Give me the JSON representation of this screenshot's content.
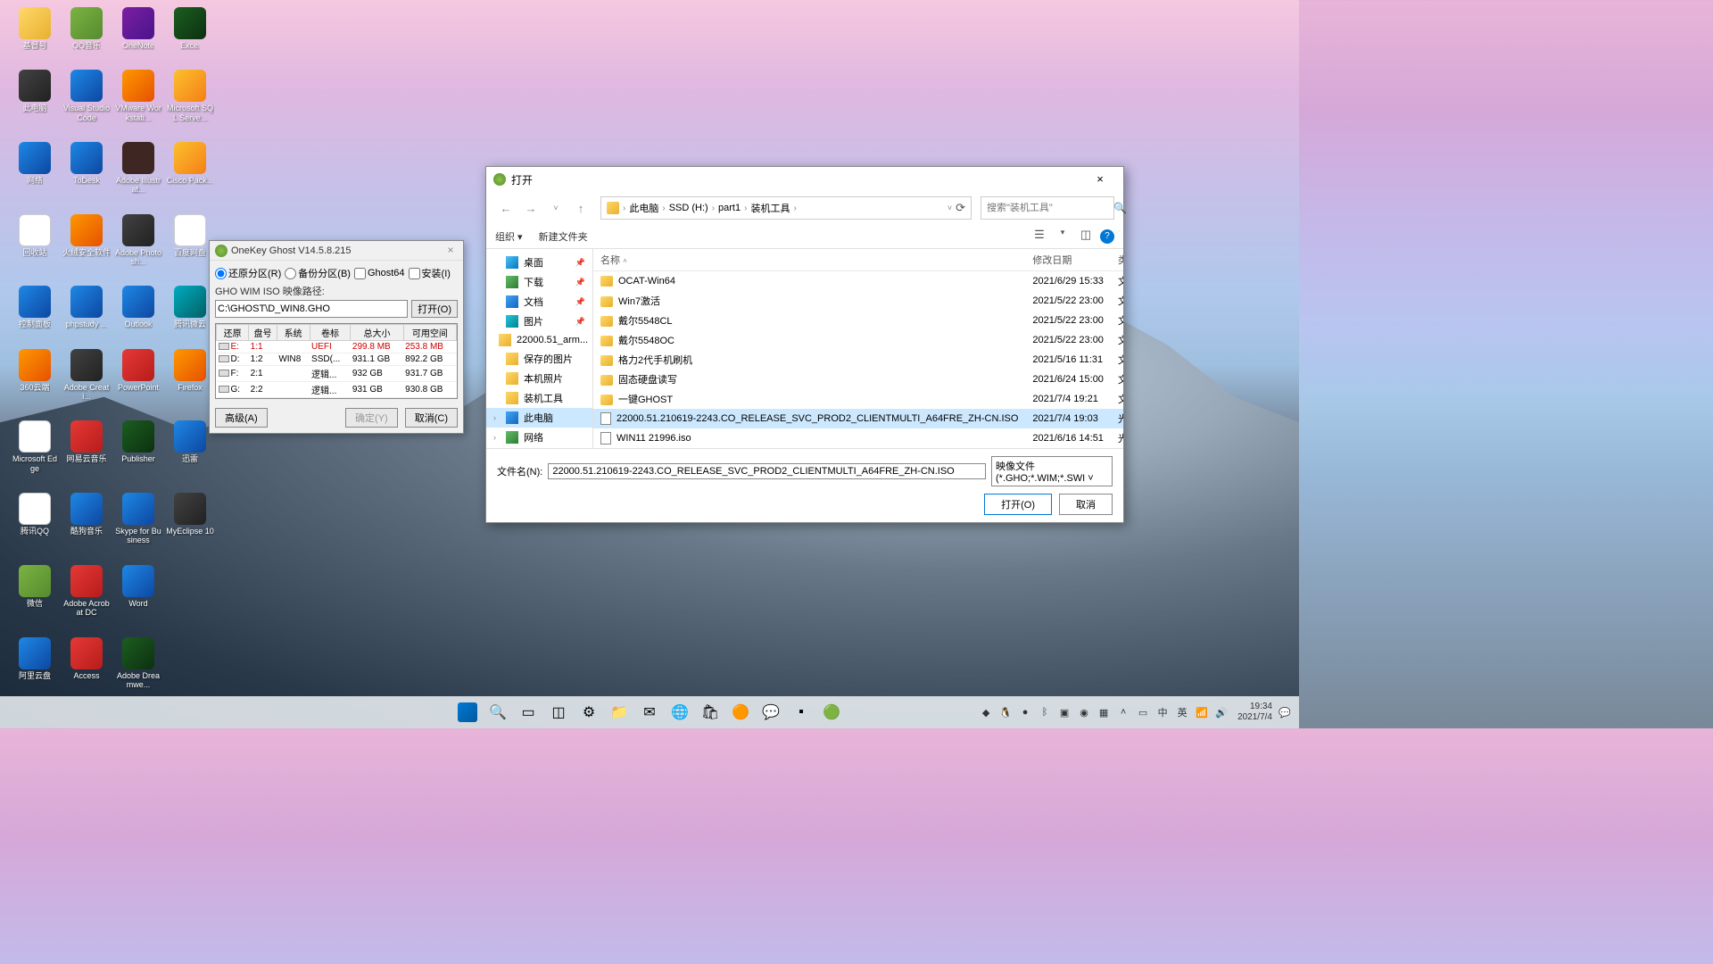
{
  "desktop": {
    "icons": [
      {
        "label": "基督号",
        "cls": "folder"
      },
      {
        "label": "QQ音乐",
        "cls": "app-green"
      },
      {
        "label": "OneNote",
        "cls": "app-purple"
      },
      {
        "label": "Excel",
        "cls": "app-dgreen"
      },
      {
        "label": "此电脑",
        "cls": "app-dark"
      },
      {
        "label": "Visual Studio Code",
        "cls": "app-blue"
      },
      {
        "label": "VMware Workstati...",
        "cls": "app-orange"
      },
      {
        "label": "Microsoft SQL Serve...",
        "cls": "app-yellow"
      },
      {
        "label": "网络",
        "cls": "app-blue"
      },
      {
        "label": "ToDesk",
        "cls": "app-blue"
      },
      {
        "label": "Adobe Illustrat...",
        "cls": "app-brown"
      },
      {
        "label": "Cisco Pack...",
        "cls": "app-yellow"
      },
      {
        "label": "回收站",
        "cls": "app-white"
      },
      {
        "label": "火绒安全软件",
        "cls": "app-orange"
      },
      {
        "label": "Adobe Photosh...",
        "cls": "app-dark"
      },
      {
        "label": "百度网盘",
        "cls": "app-white"
      },
      {
        "label": "控制面板",
        "cls": "app-blue"
      },
      {
        "label": "phpstudy ...",
        "cls": "app-blue"
      },
      {
        "label": "Outlook",
        "cls": "app-blue"
      },
      {
        "label": "腾讯微云",
        "cls": "app-teal"
      },
      {
        "label": "360云端",
        "cls": "app-orange"
      },
      {
        "label": "Adobe Creati...",
        "cls": "app-dark"
      },
      {
        "label": "PowerPoint",
        "cls": "app-red"
      },
      {
        "label": "Firefox",
        "cls": "app-orange"
      },
      {
        "label": "Microsoft Edge",
        "cls": "app-white"
      },
      {
        "label": "网易云音乐",
        "cls": "app-red"
      },
      {
        "label": "Publisher",
        "cls": "app-dgreen"
      },
      {
        "label": "迅雷",
        "cls": "app-blue"
      },
      {
        "label": "腾讯QQ",
        "cls": "app-white"
      },
      {
        "label": "酷狗音乐",
        "cls": "app-blue"
      },
      {
        "label": "Skype for Business",
        "cls": "app-blue"
      },
      {
        "label": "MyEclipse 10",
        "cls": "app-dark"
      },
      {
        "label": "微信",
        "cls": "app-green"
      },
      {
        "label": "Adobe Acrobat DC",
        "cls": "app-red"
      },
      {
        "label": "Word",
        "cls": "app-blue"
      },
      {
        "label": ""
      },
      {
        "label": "阿里云盘",
        "cls": "app-blue"
      },
      {
        "label": "Access",
        "cls": "app-red"
      },
      {
        "label": "Adobe Dreamwe...",
        "cls": "app-dgreen"
      }
    ]
  },
  "ghost": {
    "title": "OneKey Ghost V14.5.8.215",
    "radio_restore": "还原分区(R)",
    "radio_backup": "备份分区(B)",
    "chk_ghost64": "Ghost64",
    "chk_install": "安装(I)",
    "path_label": "GHO WIM ISO 映像路径:",
    "path_value": "C:\\GHOST\\D_WIN8.GHO",
    "open_btn": "打开(O)",
    "cols": [
      "还原",
      "盘号",
      "系统",
      "卷标",
      "总大小",
      "可用空间"
    ],
    "rows": [
      {
        "d": "E:",
        "n": "1:1",
        "s": "",
        "v": "UEFI",
        "t": "299.8 MB",
        "f": "253.8 MB",
        "red": true
      },
      {
        "d": "D:",
        "n": "1:2",
        "s": "WIN8",
        "v": "SSD(...",
        "t": "931.1 GB",
        "f": "892.2 GB"
      },
      {
        "d": "F:",
        "n": "2:1",
        "s": "",
        "v": "逻辑...",
        "t": "932 GB",
        "f": "931.7 GB"
      },
      {
        "d": "G:",
        "n": "2:2",
        "s": "",
        "v": "逻辑...",
        "t": "931 GB",
        "f": "930.8 GB"
      }
    ],
    "adv_btn": "高级(A)",
    "ok_btn": "确定(Y)",
    "cancel_btn": "取消(C)"
  },
  "filedlg": {
    "title": "打开",
    "crumbs": [
      "此电脑",
      "SSD (H:)",
      "part1",
      "装机工具"
    ],
    "search_ph": "搜索\"装机工具\"",
    "toolbar": {
      "org": "组织",
      "newf": "新建文件夹"
    },
    "side": [
      {
        "l": "桌面",
        "c": "sic-desktop",
        "pin": true
      },
      {
        "l": "下载",
        "c": "sic-download",
        "pin": true
      },
      {
        "l": "文档",
        "c": "sic-doc",
        "pin": true
      },
      {
        "l": "图片",
        "c": "sic-pic",
        "pin": true
      },
      {
        "l": "22000.51_arm...",
        "c": "sic-folder"
      },
      {
        "l": "保存的图片",
        "c": "sic-folder"
      },
      {
        "l": "本机照片",
        "c": "sic-folder"
      },
      {
        "l": "装机工具",
        "c": "sic-folder"
      },
      {
        "l": "此电脑",
        "c": "sic-pc",
        "sel": true,
        "exp": true
      },
      {
        "l": "网络",
        "c": "sic-net",
        "exp": true
      }
    ],
    "cols": {
      "name": "名称",
      "date": "修改日期",
      "type": "类型"
    },
    "rows": [
      {
        "n": "OCAT-Win64",
        "d": "2021/6/29 15:33",
        "t": "文件夹",
        "f": true
      },
      {
        "n": "Win7激活",
        "d": "2021/5/22 23:00",
        "t": "文件夹",
        "f": true
      },
      {
        "n": "戴尔5548CL",
        "d": "2021/5/22 23:00",
        "t": "文件夹",
        "f": true
      },
      {
        "n": "戴尔5548OC",
        "d": "2021/5/22 23:00",
        "t": "文件夹",
        "f": true
      },
      {
        "n": "格力2代手机刷机",
        "d": "2021/5/16 11:31",
        "t": "文件夹",
        "f": true
      },
      {
        "n": "固态硬盘读写",
        "d": "2021/6/24 15:00",
        "t": "文件夹",
        "f": true
      },
      {
        "n": "一键GHOST",
        "d": "2021/7/4 19:21",
        "t": "文件夹",
        "f": true
      },
      {
        "n": "22000.51.210619-2243.CO_RELEASE_SVC_PROD2_CLIENTMULTI_A64FRE_ZH-CN.ISO",
        "d": "2021/7/4 19:03",
        "t": "光盘映像文件",
        "sel": true
      },
      {
        "n": "WIN11 21996.iso",
        "d": "2021/6/16 14:51",
        "t": "光盘映像文件"
      }
    ],
    "fn_label": "文件名(N):",
    "fn_value": "22000.51.210619-2243.CO_RELEASE_SVC_PROD2_CLIENTMULTI_A64FRE_ZH-CN.ISO",
    "filter": "映像文件 (*.GHO;*.WIM;*.SWI",
    "open_btn": "打开(O)",
    "cancel_btn": "取消"
  },
  "taskbar": {
    "time": "19:34",
    "date": "2021/7/4",
    "ime": "中",
    "ime2": "英"
  }
}
